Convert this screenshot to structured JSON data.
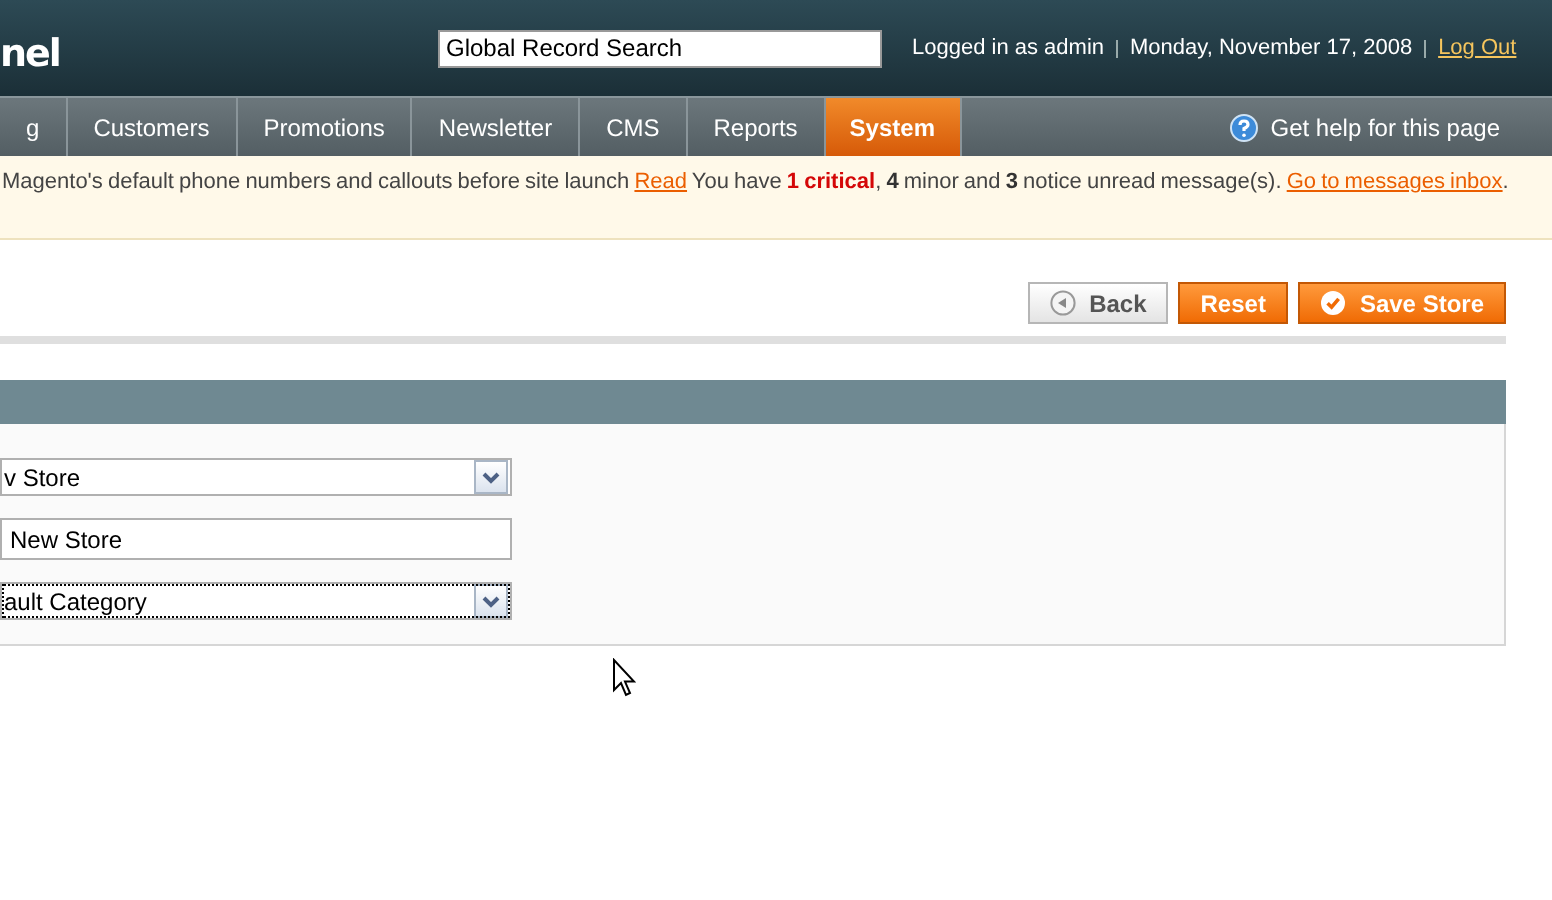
{
  "header": {
    "logo": "nel",
    "search": {
      "value": "Global Record Search"
    },
    "user": "Logged in as admin",
    "date": "Monday, November 17, 2008",
    "logout": "Log Out"
  },
  "nav": {
    "tabs": [
      {
        "label": "g",
        "selected": false
      },
      {
        "label": "Customers",
        "selected": false
      },
      {
        "label": "Promotions",
        "selected": false
      },
      {
        "label": "Newsletter",
        "selected": false
      },
      {
        "label": "CMS",
        "selected": false
      },
      {
        "label": "Reports",
        "selected": false
      },
      {
        "label": "System",
        "selected": true
      }
    ],
    "help": "Get help for this page"
  },
  "notice": [
    {
      "kind": "text",
      "text": "Magento's default phone numbers and callouts before site launch"
    },
    {
      "kind": "link",
      "text": "Read"
    },
    {
      "kind": "text",
      "text": "You have"
    },
    {
      "kind": "critical",
      "text": "1 critical"
    },
    {
      "kind": "text",
      "text": ","
    },
    {
      "kind": "bold",
      "text": "4"
    },
    {
      "kind": "text",
      "text": "minor and"
    },
    {
      "kind": "bold",
      "text": "3"
    },
    {
      "kind": "text",
      "text": "notice unread message(s)."
    },
    {
      "kind": "link",
      "text": "Go to messages inbox"
    },
    {
      "kind": "text",
      "text": "."
    }
  ],
  "buttons": [
    {
      "label": "Back",
      "kind": "back"
    },
    {
      "label": "Reset",
      "kind": "reset"
    },
    {
      "label": "Save Store",
      "kind": "save"
    }
  ],
  "fields": [
    {
      "kind": "select",
      "value": "v Store",
      "focused": false
    },
    {
      "kind": "input",
      "value": "New Store",
      "focused": false
    },
    {
      "kind": "select",
      "value": "ault Category",
      "focused": true
    }
  ]
}
